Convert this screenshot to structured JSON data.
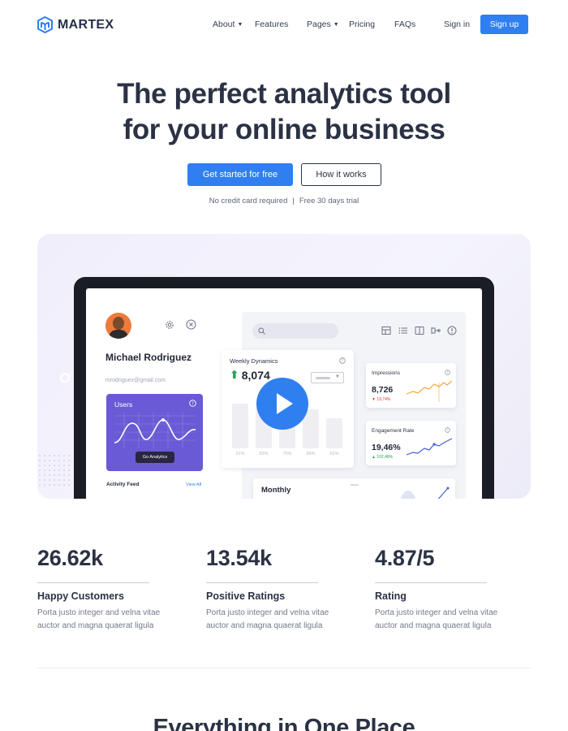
{
  "brand": {
    "name": "MARTEX",
    "accent": "#2f7ff0",
    "logo_icon": "cube-logo-icon"
  },
  "nav": {
    "items": [
      {
        "label": "About",
        "has_dropdown": true
      },
      {
        "label": "Features",
        "has_dropdown": false
      },
      {
        "label": "Pages",
        "has_dropdown": true
      },
      {
        "label": "Pricing",
        "has_dropdown": false
      },
      {
        "label": "FAQs",
        "has_dropdown": false
      }
    ],
    "signin": "Sign in",
    "signup": "Sign up"
  },
  "hero": {
    "title_line1": "The perfect analytics tool",
    "title_line2": "for your online business",
    "primary_cta": "Get started for free",
    "secondary_cta": "How it works",
    "note_left": "No credit card required",
    "note_sep": "|",
    "note_right": "Free 30 days trial"
  },
  "dashboard": {
    "profile": {
      "name": "Michael Rodriguez",
      "email": "mrodriguez@gmail.com"
    },
    "users_card": {
      "title": "Users",
      "button": "Go Analytics"
    },
    "activity": {
      "title": "Activity Feed",
      "link": "View All"
    },
    "weekly": {
      "title": "Weekly Dynamics",
      "value": "8,074",
      "bars": [
        {
          "label": "91%",
          "value": 91
        },
        {
          "label": "83%",
          "value": 83
        },
        {
          "label": "76%",
          "value": 76
        },
        {
          "label": "80%",
          "value": 80
        },
        {
          "label": "62%",
          "value": 62
        }
      ]
    },
    "impressions": {
      "title": "Impressions",
      "value": "8,726",
      "delta": "▼ 19,74%",
      "delta_color": "#e0403c"
    },
    "engagement": {
      "title": "Engagement Rate",
      "value": "19,46%",
      "delta": "▲ 102,48%",
      "delta_color": "#29a35a"
    },
    "monthly": {
      "title": "Monthly"
    },
    "play_icon": "play-icon"
  },
  "stats": [
    {
      "value": "26.62k",
      "label": "Happy Customers",
      "desc": "Porta justo integer and velna vitae auctor and magna quaerat ligula"
    },
    {
      "value": "13.54k",
      "label": "Positive Ratings",
      "desc": "Porta justo integer and velna vitae auctor and magna quaerat ligula"
    },
    {
      "value": "4.87/5",
      "label": "Rating",
      "desc": "Porta justo integer and velna vitae auctor and magna quaerat ligula"
    }
  ],
  "section": {
    "title": "Everything in One Place"
  }
}
